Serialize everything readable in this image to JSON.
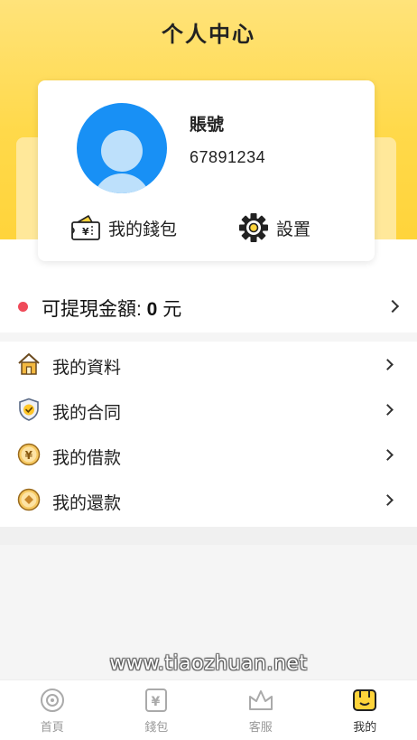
{
  "page": {
    "title": "个人中心"
  },
  "profile": {
    "account_label": "賬號",
    "account_number": "67891234",
    "wallet_label": "我的錢包",
    "settings_label": "設置"
  },
  "withdrawable": {
    "label": "可提現金額: ",
    "amount": "0",
    "unit": " 元"
  },
  "menu": [
    {
      "label": "我的資料",
      "icon": "house-icon"
    },
    {
      "label": "我的合同",
      "icon": "shield-check-icon"
    },
    {
      "label": "我的借款",
      "icon": "yen-coin-icon"
    },
    {
      "label": "我的還款",
      "icon": "coin-icon"
    }
  ],
  "watermark": "www.tiaozhuan.net",
  "tabbar": [
    {
      "label": "首頁",
      "icon": "home-circle-icon",
      "active": false
    },
    {
      "label": "錢包",
      "icon": "wallet-yen-icon",
      "active": false
    },
    {
      "label": "客服",
      "icon": "crown-icon",
      "active": false
    },
    {
      "label": "我的",
      "icon": "profile-icon",
      "active": true
    }
  ],
  "colors": {
    "accent_yellow": "#ffd43b",
    "avatar_blue": "#1890f5",
    "dot_red": "#ef4a59"
  }
}
